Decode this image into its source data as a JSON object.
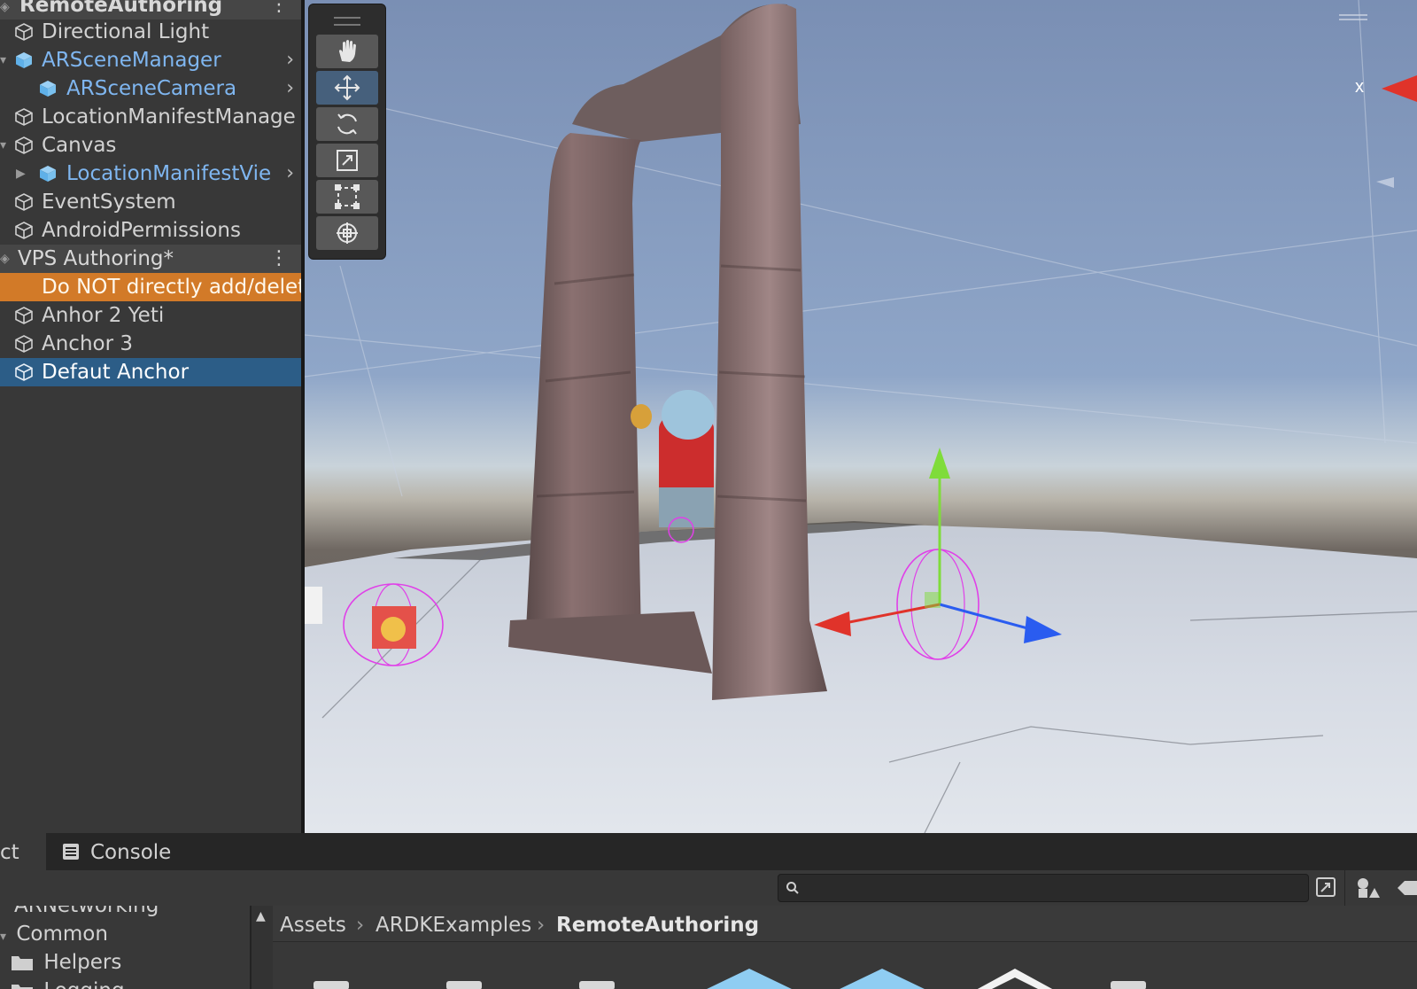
{
  "hierarchy": {
    "scene1_title": "RemoteAuthoring",
    "items1": [
      {
        "label": "Directional Light"
      },
      {
        "label": "ARSceneManager"
      },
      {
        "label": "ARSceneCamera"
      },
      {
        "label": "LocationManifestManage"
      },
      {
        "label": "Canvas"
      },
      {
        "label": "LocationManifestVie"
      },
      {
        "label": "EventSystem"
      },
      {
        "label": "AndroidPermissions"
      }
    ],
    "scene2_title": "VPS Authoring*",
    "warning": "Do NOT directly add/delet",
    "items2": [
      {
        "label": "Anhor 2 Yeti"
      },
      {
        "label": "Anchor 3"
      },
      {
        "label": "Defaut Anchor"
      }
    ]
  },
  "scene_view": {
    "axis_label": "x",
    "colors": {
      "x_axis": "#e0332a",
      "y_axis": "#7fdc3a",
      "z_axis": "#2a5cf0",
      "selection": "#e040e8"
    }
  },
  "toolbar": {
    "tools": [
      "hand-icon",
      "move-icon",
      "rotate-icon",
      "scale-icon",
      "rect-icon",
      "transform-icon"
    ],
    "active": "move-icon"
  },
  "bottom": {
    "tabs": [
      {
        "label": "ct"
      },
      {
        "label": "Console"
      }
    ],
    "tree": [
      {
        "label": "ARNetworking"
      },
      {
        "label": "Common"
      },
      {
        "label": "Helpers"
      },
      {
        "label": "Logging"
      }
    ],
    "breadcrumb": [
      "Assets",
      "ARDKExamples",
      "RemoteAuthoring"
    ]
  }
}
